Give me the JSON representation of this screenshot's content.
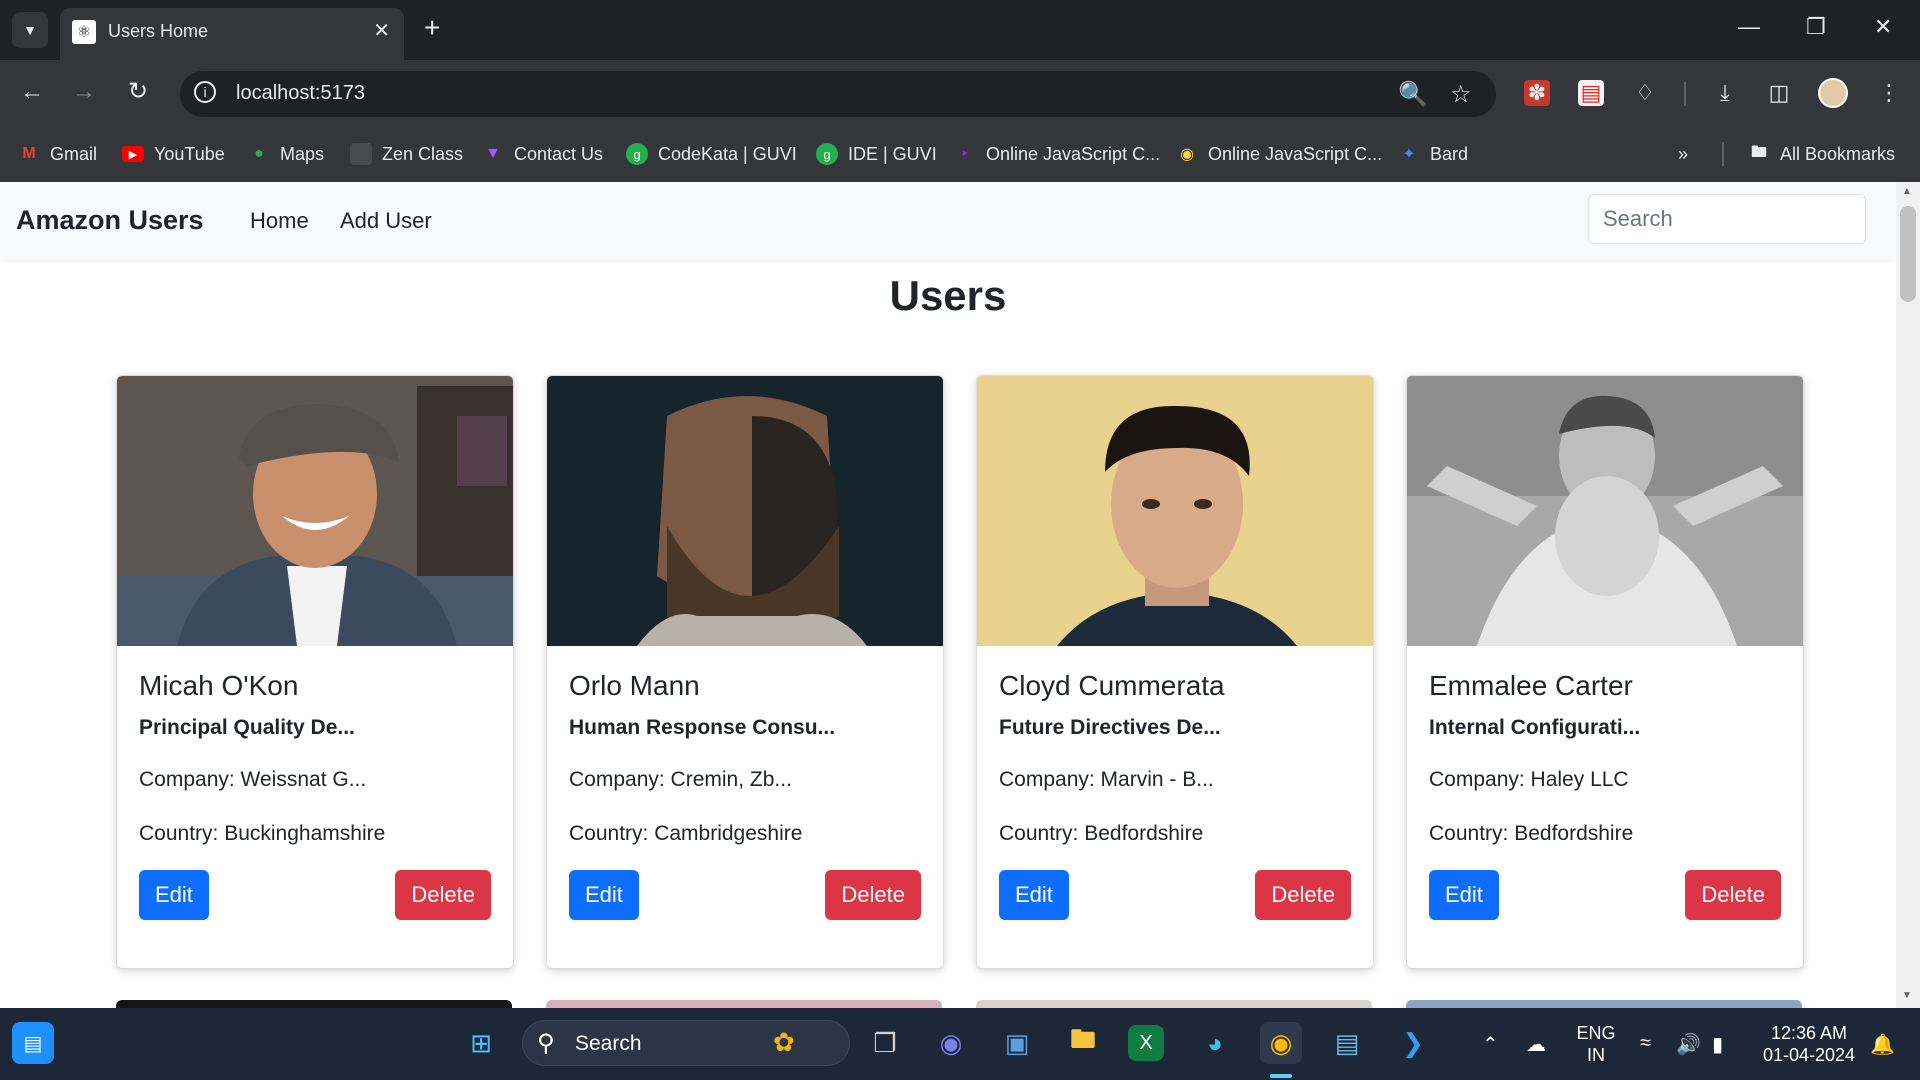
{
  "browser": {
    "tab": {
      "title": "Users Home"
    },
    "address_bar": {
      "url": "localhost:5173"
    },
    "bookmarks": [
      {
        "label": "Gmail",
        "icon": "gmail-icon"
      },
      {
        "label": "YouTube",
        "icon": "youtube-icon"
      },
      {
        "label": "Maps",
        "icon": "maps-icon"
      },
      {
        "label": "Zen Class",
        "icon": "zen-class-icon"
      },
      {
        "label": "Contact Us",
        "icon": "contact-us-icon"
      },
      {
        "label": "CodeKata | GUVI",
        "icon": "guvi-icon"
      },
      {
        "label": "IDE | GUVI",
        "icon": "guvi-icon"
      },
      {
        "label": "Online JavaScript C...",
        "icon": "javascript-icon"
      },
      {
        "label": "Online JavaScript C...",
        "icon": "python-icon"
      },
      {
        "label": "Bard",
        "icon": "bard-icon"
      }
    ],
    "all_bookmarks": "All Bookmarks"
  },
  "app": {
    "brand": "Amazon Users",
    "nav": {
      "home": "Home",
      "add_user": "Add User"
    },
    "search": {
      "placeholder": "Search",
      "value": ""
    },
    "title": "Users",
    "users": [
      {
        "name": "Micah O'Kon",
        "role": "Principal Quality De...",
        "company": "Company: Weissnat G...",
        "country": "Country: Buckinghamshire",
        "edit": "Edit",
        "delete": "Delete"
      },
      {
        "name": "Orlo Mann",
        "role": "Human Response Consu...",
        "company": "Company: Cremin, Zb...",
        "country": "Country: Cambridgeshire",
        "edit": "Edit",
        "delete": "Delete"
      },
      {
        "name": "Cloyd Cummerata",
        "role": "Future Directives De...",
        "company": "Company: Marvin - B...",
        "country": "Country: Bedfordshire",
        "edit": "Edit",
        "delete": "Delete"
      },
      {
        "name": "Emmalee Carter",
        "role": "Internal Configurati...",
        "company": "Company: Haley LLC",
        "country": "Country: Bedfordshire",
        "edit": "Edit",
        "delete": "Delete"
      }
    ]
  },
  "taskbar": {
    "search": "Search",
    "language": {
      "line1": "ENG",
      "line2": "IN"
    },
    "time": "12:36 AM",
    "date": "01-04-2024"
  },
  "colors": {
    "primary": "#0d6efd",
    "danger": "#dc3545",
    "navbar_bg": "#f8f9fa",
    "chrome_dark": "#202124",
    "chrome_toolbar": "#35363a",
    "taskbar": "#1c2738"
  }
}
